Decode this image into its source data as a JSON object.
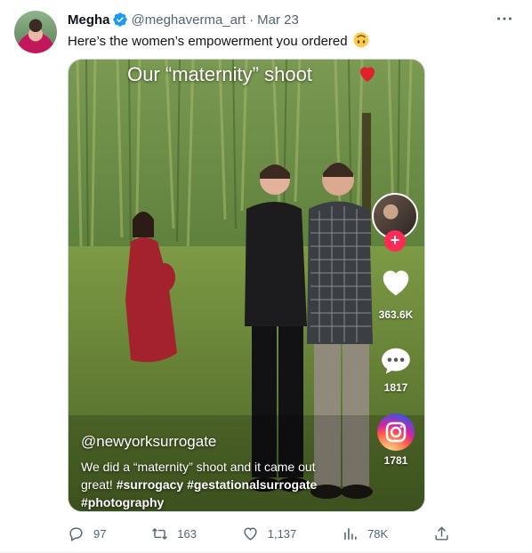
{
  "tweet": {
    "display_name": "Megha",
    "handle": "@meghaverma_art",
    "separator": "·",
    "date": "Mar 23",
    "text": "Here’s the women’s empowerment you ordered"
  },
  "media": {
    "overlay_title": "Our “maternity” shoot",
    "like_count": "363.6K",
    "comment_count": "1817",
    "share_count": "1781",
    "username": "@newyorksurrogate",
    "caption_plain": "We did a “maternity” shoot and it came out great! ",
    "caption_tag1": "#surrogacy",
    "caption_tag2": "#gestationalsurrogate #photography",
    "follow_plus": "+"
  },
  "actions": {
    "replies": "97",
    "retweets": "163",
    "likes": "1,137",
    "views": "78K"
  },
  "colors": {
    "verified": "#1d9bf0",
    "muted_text": "#536471",
    "tiktok_red": "#fe2c55"
  },
  "icons": {
    "verified": "verified-badge-icon",
    "more": "more-dots-icon",
    "emoji": "upside-down-face-emoji",
    "reply": "reply-icon",
    "retweet": "retweet-icon",
    "like": "heart-icon",
    "views": "views-chart-icon",
    "share": "share-icon"
  }
}
